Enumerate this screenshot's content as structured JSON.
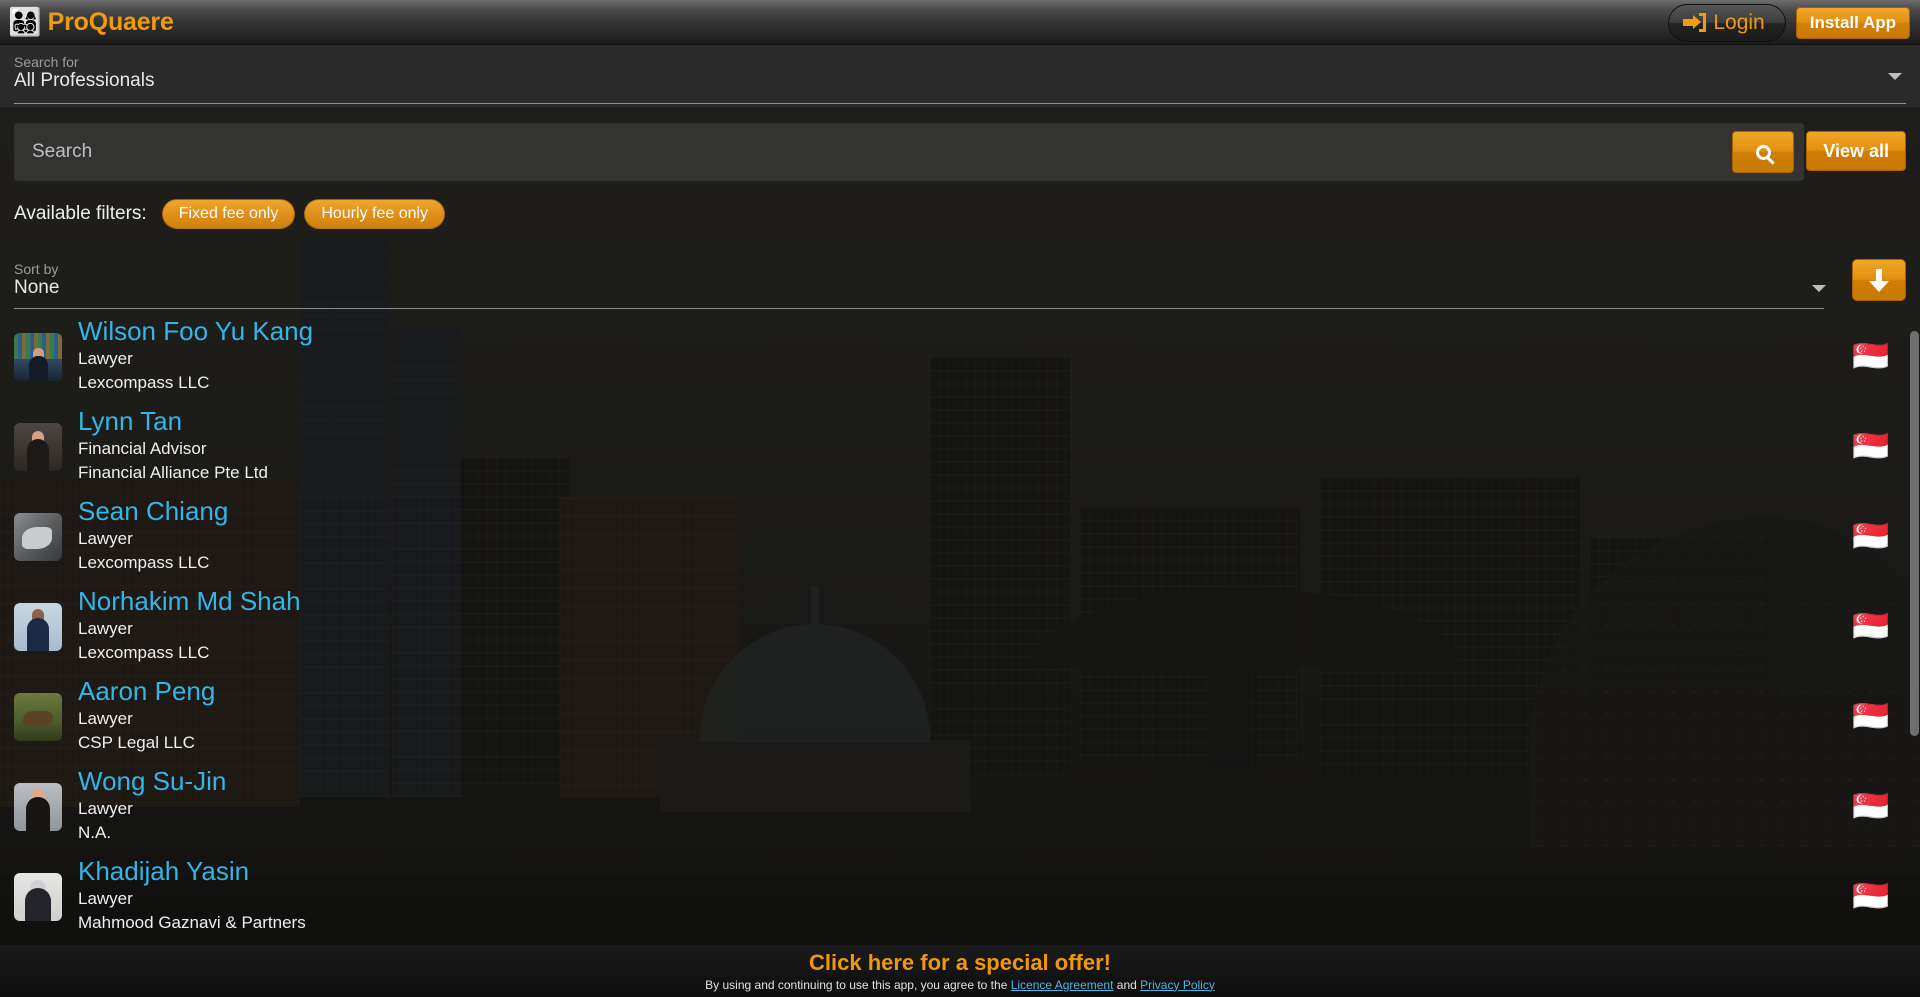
{
  "header": {
    "logo_icon": "people-group-icon",
    "logo_glyph": "👨‍👩‍👧‍👦",
    "brand": "ProQuaere",
    "login_label": "Login",
    "login_icon": "login-arrow-icon",
    "install_label": "Install App"
  },
  "search_for": {
    "label": "Search for",
    "value": "All Professionals",
    "chevron_icon": "chevron-down-icon"
  },
  "search": {
    "placeholder": "Search",
    "value": "",
    "go_icon": "search-icon",
    "view_all_label": "View all"
  },
  "filters": {
    "label": "Available filters:",
    "items": [
      {
        "label": "Fixed fee only"
      },
      {
        "label": "Hourly fee only"
      }
    ]
  },
  "sort": {
    "label": "Sort by",
    "value": "None",
    "chevron_icon": "chevron-down-icon",
    "direction_icon": "arrow-down-icon"
  },
  "results": [
    {
      "name": "Wilson Foo Yu Kang",
      "role": "Lawyer",
      "org": "Lexcompass LLC",
      "avatar": "av-books",
      "flag": "🇸🇬",
      "flag_icon": "singapore-flag-icon"
    },
    {
      "name": "Lynn Tan",
      "role": "Financial Advisor",
      "org": "Financial Alliance Pte Ltd",
      "avatar": "av-lynn",
      "flag": "🇸🇬",
      "flag_icon": "singapore-flag-icon"
    },
    {
      "name": "Sean Chiang",
      "role": "Lawyer",
      "org": "Lexcompass LLC",
      "avatar": "av-bike",
      "flag": "🇸🇬",
      "flag_icon": "singapore-flag-icon"
    },
    {
      "name": "Norhakim Md Shah",
      "role": "Lawyer",
      "org": "Lexcompass LLC",
      "avatar": "av-nor",
      "flag": "🇸🇬",
      "flag_icon": "singapore-flag-icon"
    },
    {
      "name": "Aaron Peng",
      "role": "Lawyer",
      "org": "CSP Legal LLC",
      "avatar": "av-bear",
      "flag": "🇸🇬",
      "flag_icon": "singapore-flag-icon"
    },
    {
      "name": "Wong Su-Jin",
      "role": "Lawyer",
      "org": "N.A.",
      "avatar": "av-wong",
      "flag": "🇸🇬",
      "flag_icon": "singapore-flag-icon"
    },
    {
      "name": "Khadijah Yasin",
      "role": "Lawyer",
      "org": "Mahmood Gaznavi & Partners",
      "avatar": "av-khad",
      "flag": "🇸🇬",
      "flag_icon": "singapore-flag-icon"
    }
  ],
  "footer": {
    "offer_text": "Click here for a special offer!",
    "legal_prefix": "By using and continuing to use this app, you agree to the ",
    "licence_link": "Licence Agreement",
    "legal_join": " and ",
    "privacy_link": "Privacy Policy"
  },
  "colors": {
    "accent": "#f09a10",
    "link": "#33b6e6",
    "panel": "#2a2a2a",
    "text": "#efefef"
  }
}
